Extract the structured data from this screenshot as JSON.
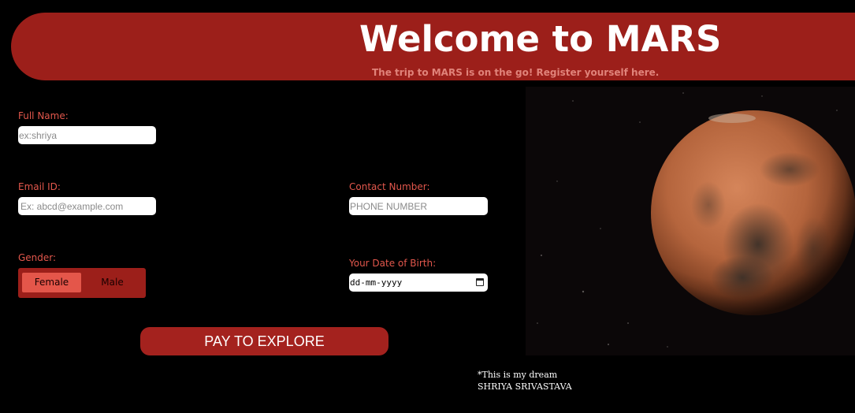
{
  "header": {
    "title": "Welcome to MARS",
    "subtitle": "The trip to MARS is on the go! Register yourself here."
  },
  "form": {
    "full_name": {
      "label": "Full Name:",
      "placeholder": "ex:shriya"
    },
    "email": {
      "label": "Email ID:",
      "placeholder": "Ex: abcd@example.com"
    },
    "contact": {
      "label": "Contact Number:",
      "placeholder": "PHONE NUMBER"
    },
    "gender": {
      "label": "Gender:",
      "options": [
        "Female",
        "Male"
      ],
      "selected": "Female"
    },
    "dob": {
      "label": "Your Date of Birth:",
      "placeholder": "dd-mm-yyyy"
    },
    "submit_label": "PAY TO EXPLORE"
  },
  "footer_note": {
    "line1": "*This is my dream",
    "line2": "SHRIYA SRIVASTAVA"
  },
  "icons": [
    "calendar-icon"
  ],
  "colors": {
    "header_bg": "#9c1f1a",
    "label_text": "#e2574c",
    "button_bg": "#a4221e",
    "page_bg": "#000000"
  }
}
